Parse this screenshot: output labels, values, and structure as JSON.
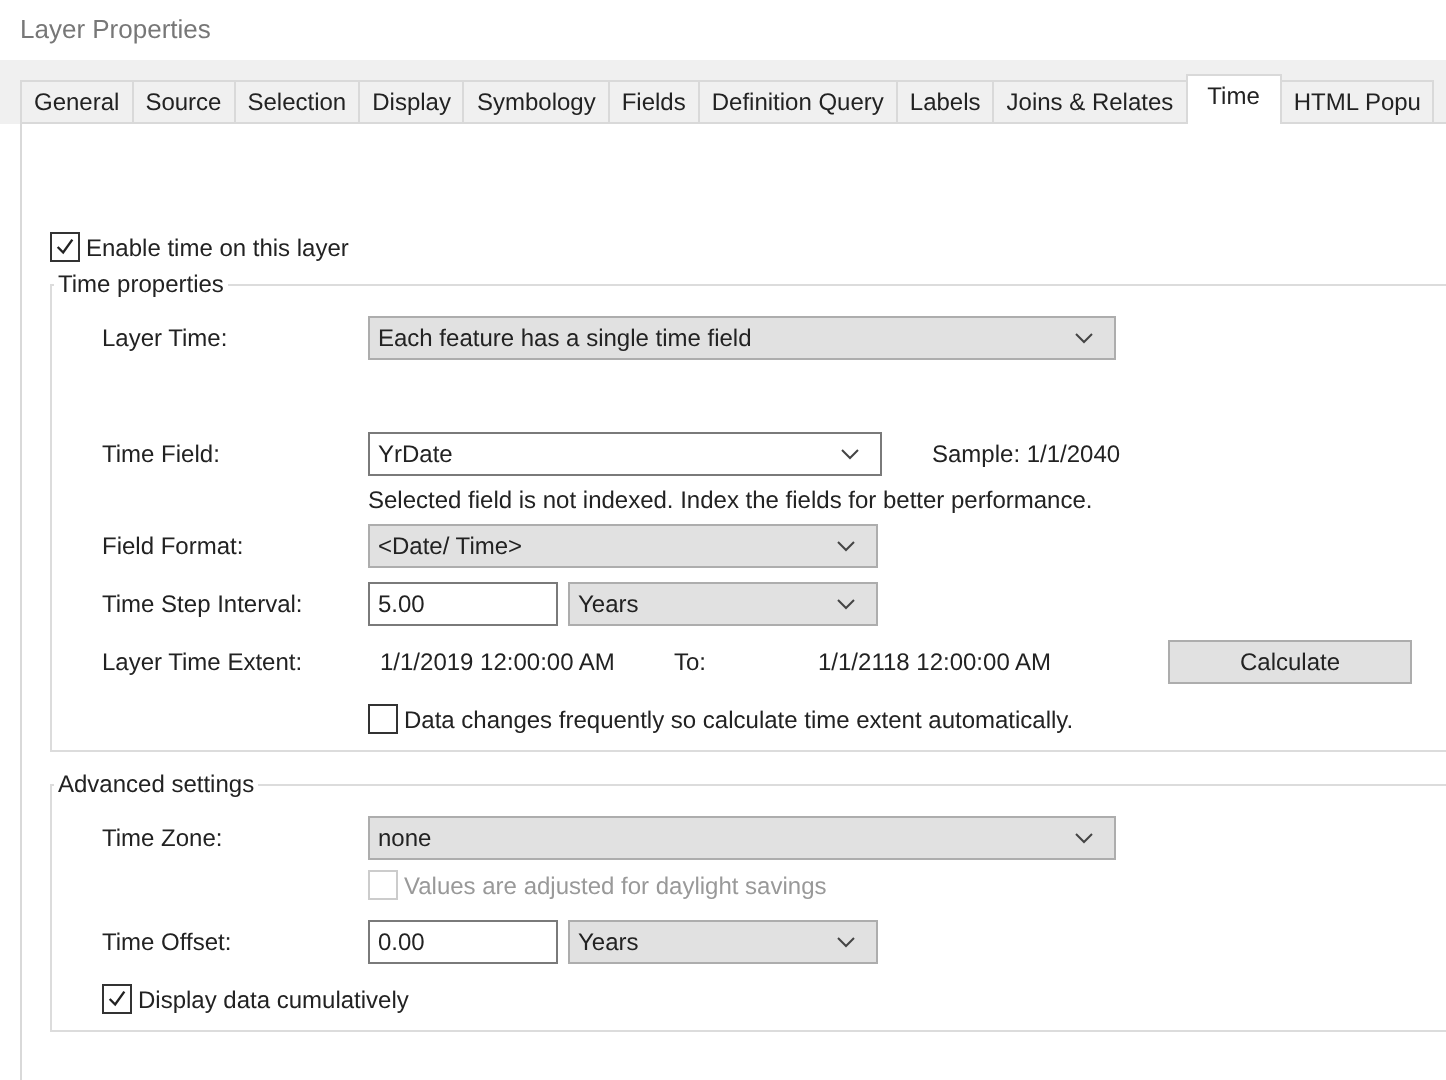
{
  "window": {
    "title": "Layer Properties"
  },
  "tabs": [
    {
      "label": "General",
      "selected": false
    },
    {
      "label": "Source",
      "selected": false
    },
    {
      "label": "Selection",
      "selected": false
    },
    {
      "label": "Display",
      "selected": false
    },
    {
      "label": "Symbology",
      "selected": false
    },
    {
      "label": "Fields",
      "selected": false
    },
    {
      "label": "Definition Query",
      "selected": false
    },
    {
      "label": "Labels",
      "selected": false
    },
    {
      "label": "Joins & Relates",
      "selected": false
    },
    {
      "label": "Time",
      "selected": true
    },
    {
      "label": "HTML Popu",
      "selected": false
    }
  ],
  "enable_time": {
    "label": "Enable time on this layer",
    "checked": true
  },
  "time_properties": {
    "title": "Time properties",
    "layer_time": {
      "label": "Layer Time:",
      "value": "Each feature has a single time field"
    },
    "time_field": {
      "label": "Time Field:",
      "value": "YrDate",
      "sample": "Sample: 1/1/2040",
      "note": "Selected field is not indexed. Index the fields for better performance."
    },
    "field_format": {
      "label": "Field Format:",
      "value": "<Date/ Time>"
    },
    "time_step": {
      "label": "Time Step Interval:",
      "value": "5.00",
      "unit": "Years"
    },
    "extent": {
      "label": "Layer Time Extent:",
      "from": "1/1/2019 12:00:00 AM",
      "to_label": "To:",
      "to": "1/1/2118 12:00:00 AM",
      "button": "Calculate"
    },
    "auto_calc": {
      "label": "Data changes frequently so calculate time extent automatically.",
      "checked": false,
      "disabled": false
    }
  },
  "advanced": {
    "title": "Advanced settings",
    "time_zone": {
      "label": "Time Zone:",
      "value": "none"
    },
    "daylight": {
      "label": "Values are adjusted for daylight savings",
      "checked": false,
      "disabled": true
    },
    "time_offset": {
      "label": "Time Offset:",
      "value": "0.00",
      "unit": "Years"
    },
    "cumulative": {
      "label": "Display data cumulatively",
      "checked": true,
      "disabled": false
    }
  }
}
